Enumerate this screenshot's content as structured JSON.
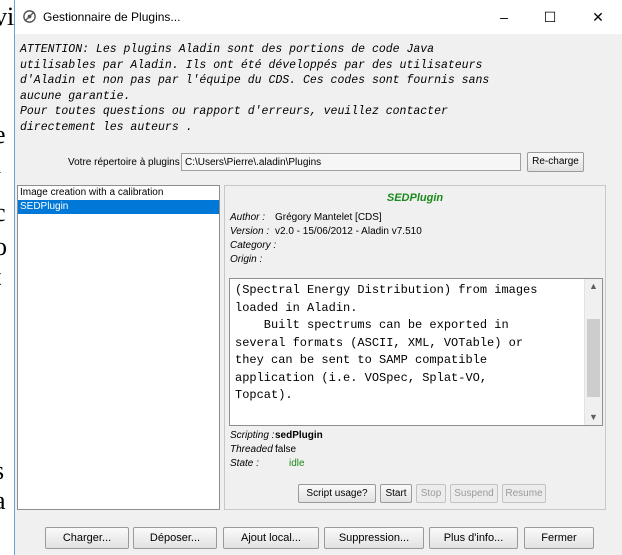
{
  "background_letters": [
    "vi",
    "e",
    "i",
    "c",
    "o",
    "t",
    "s",
    "a"
  ],
  "window": {
    "title": "Gestionnaire de Plugins...",
    "minimize": "–",
    "maximize": "☐",
    "close": "✕"
  },
  "notice": [
    "ATTENTION: Les plugins Aladin sont des portions de code Java",
    "utilisables par Aladin. Ils ont été développés par des utilisateurs",
    "d'Aladin et non pas par l'équipe du CDS. Ces codes sont fournis sans",
    "aucune garantie.",
    "Pour toutes questions ou rapport d'erreurs, veuillez contacter",
    "directement les auteurs ."
  ],
  "directory": {
    "label": "Votre répertoire à plugins",
    "value": "C:\\Users\\Pierre\\.aladin\\Plugins",
    "reload_button": "Re-charge"
  },
  "plugin_list": [
    {
      "label": "Image creation with a calibration",
      "selected": false
    },
    {
      "label": "SEDPlugin",
      "selected": true
    }
  ],
  "details": {
    "name": "SEDPlugin",
    "author_key": "Author :",
    "author": "Grégory Mantelet [CDS]",
    "version_key": "Version :",
    "version": "v2.0 - 15/06/2012 - Aladin v7.510",
    "category_key": "Category :",
    "origin_key": "Origin :",
    "description": [
      "(Spectral Energy Distribution) from images",
      "loaded in Aladin.",
      "",
      "    Built spectrums can be exported in",
      "several formats (ASCII, XML, VOTable) or",
      "they can be sent to SAMP compatible",
      "application (i.e. VOSpec, Splat-VO,",
      "Topcat)."
    ],
    "scripting_key": "Scripting :",
    "scripting": "sedPlugin",
    "threaded_key": "Threaded :",
    "threaded": "false",
    "state_key": "State :",
    "state": "idle",
    "buttons": {
      "script_usage": "Script usage?",
      "start": "Start",
      "stop": "Stop",
      "suspend": "Suspend",
      "resume": "Resume"
    }
  },
  "footer_buttons": {
    "load": "Charger...",
    "deposit": "Déposer...",
    "add_local": "Ajout local...",
    "delete": "Suppression...",
    "more_info": "Plus d'info...",
    "close": "Fermer"
  },
  "colors": {
    "selection": "#0078d7",
    "plugin_name": "#1a8a1a",
    "state_idle": "#1a8a1a"
  }
}
